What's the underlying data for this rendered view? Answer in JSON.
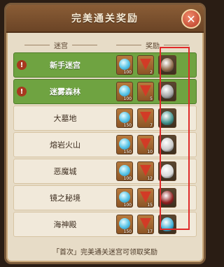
{
  "title": "完美通关奖励",
  "headers": {
    "left": "迷宫",
    "right": "奖励"
  },
  "rows": [
    {
      "name": "新手迷宫",
      "done": true,
      "alert": true,
      "gem_qty": "100",
      "flag_qty": "2",
      "item_icon": "helmet-icon",
      "item_color": "#8e6b4a"
    },
    {
      "name": "迷雾森林",
      "done": true,
      "alert": true,
      "gem_qty": "100",
      "flag_qty": "5",
      "item_icon": "helmet-icon",
      "item_color": "#a3a3a3"
    },
    {
      "name": "大墓地",
      "done": false,
      "alert": false,
      "gem_qty": "150",
      "flag_qty": "7",
      "item_icon": "armor-icon",
      "item_color": "#3f8f8a"
    },
    {
      "name": "熔岩火山",
      "done": false,
      "alert": false,
      "gem_qty": "150",
      "flag_qty": "10",
      "item_icon": "mask-icon",
      "item_color": "#c9c9c9"
    },
    {
      "name": "恶魔城",
      "done": false,
      "alert": false,
      "gem_qty": "100",
      "flag_qty": "12",
      "item_icon": "blade-icon",
      "item_color": "#d7d7d7"
    },
    {
      "name": "镜之秘境",
      "done": false,
      "alert": false,
      "gem_qty": "100",
      "flag_qty": "15",
      "item_icon": "blade-icon",
      "item_color": "#8f1f1f"
    },
    {
      "name": "海神殿",
      "done": false,
      "alert": false,
      "gem_qty": "150",
      "flag_qty": "17",
      "item_icon": "helmet-icon",
      "item_color": "#3aaed6"
    }
  ],
  "footer": "「首次」完美通关迷宫可领取奖励",
  "alert_symbol": "!",
  "close_symbol": "✕"
}
